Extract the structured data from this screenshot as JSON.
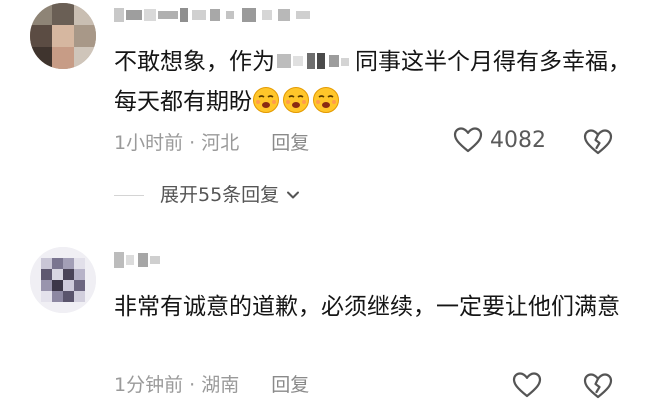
{
  "comments": [
    {
      "body_parts": [
        "不敢想象，作为",
        "同事这半个月得有多幸福，每天都有期盼"
      ],
      "emoji_count": 3,
      "emoji_name": "wink-emoji",
      "time": "1小时前",
      "separator": "·",
      "location": "河北",
      "reply_label": "回复",
      "like_count": "4082",
      "expand_label": "展开55条回复"
    },
    {
      "body": "非常有诚意的道歉，必须继续，一定要让他们满意",
      "time": "1分钟前",
      "separator": "·",
      "location": "湖南",
      "reply_label": "回复",
      "like_count": ""
    }
  ],
  "colors": {
    "text": "#151515",
    "meta": "#9a9a9a",
    "icon": "#555555"
  }
}
